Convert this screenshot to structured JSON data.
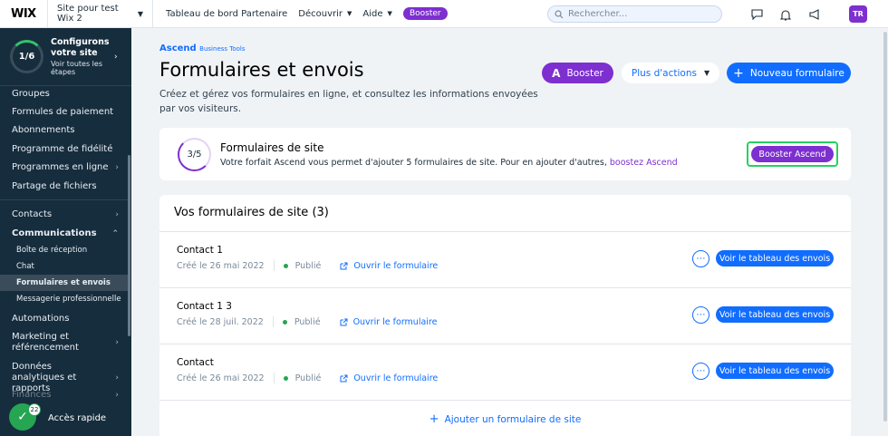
{
  "topbar": {
    "logo": "WIX",
    "site_name": "Site pour test Wix 2",
    "nav": [
      "Tableau de bord Partenaire",
      "Découvrir",
      "Aide"
    ],
    "booster_badge": "Booster",
    "search_placeholder": "Rechercher...",
    "avatar_initials": "TR"
  },
  "sidebar": {
    "setup": {
      "progress": "1/6",
      "title": "Configurons votre site",
      "subtitle": "Voir toutes les étapes"
    },
    "items": [
      {
        "label": "Groupes"
      },
      {
        "label": "Formules de paiement"
      },
      {
        "label": "Abonnements"
      },
      {
        "label": "Programme de fidélité"
      },
      {
        "label": "Programmes en ligne"
      },
      {
        "label": "Partage de fichiers"
      },
      {
        "label": "Contacts"
      },
      {
        "label": "Communications"
      },
      {
        "label": "Automations"
      },
      {
        "label": "Marketing et référencement"
      },
      {
        "label": "Données analytiques et rapports"
      },
      {
        "label": "Finances"
      }
    ],
    "sub_items": [
      "Boîte de réception",
      "Chat",
      "Formulaires et envois",
      "Messagerie professionnelle"
    ],
    "quick_access": {
      "label": "Accès rapide",
      "badge": "22"
    }
  },
  "main": {
    "brand": "Ascend",
    "brand_sub": "Business Tools",
    "title": "Formulaires et envois",
    "description": "Créez et gérez vos formulaires en ligne, et consultez les informations envoyées par vos visiteurs.",
    "booster_button": "Booster",
    "more_actions": "Plus d'actions",
    "new_form": "Nouveau formulaire",
    "site_forms_card": {
      "usage": "3/5",
      "title": "Formulaires de site",
      "description": "Votre forfait Ascend vous permet d'ajouter 5 formulaires de site. Pour en ajouter d'autres,",
      "link": "boostez Ascend",
      "button": "Booster Ascend"
    },
    "forms_list": {
      "title": "Vos formulaires de site (3)",
      "rows": [
        {
          "name": "Contact 1",
          "created": "Créé le 26 mai 2022",
          "status": "Publié",
          "open": "Ouvrir le formulaire",
          "action": "Voir le tableau des envois"
        },
        {
          "name": "Contact 1 3",
          "created": "Créé le 28 juil. 2022",
          "status": "Publié",
          "open": "Ouvrir le formulaire",
          "action": "Voir le tableau des envois"
        },
        {
          "name": "Contact",
          "created": "Créé le 26 mai 2022",
          "status": "Publié",
          "open": "Ouvrir le formulaire",
          "action": "Voir le tableau des envois"
        }
      ],
      "add": "Ajouter un formulaire de site"
    }
  }
}
